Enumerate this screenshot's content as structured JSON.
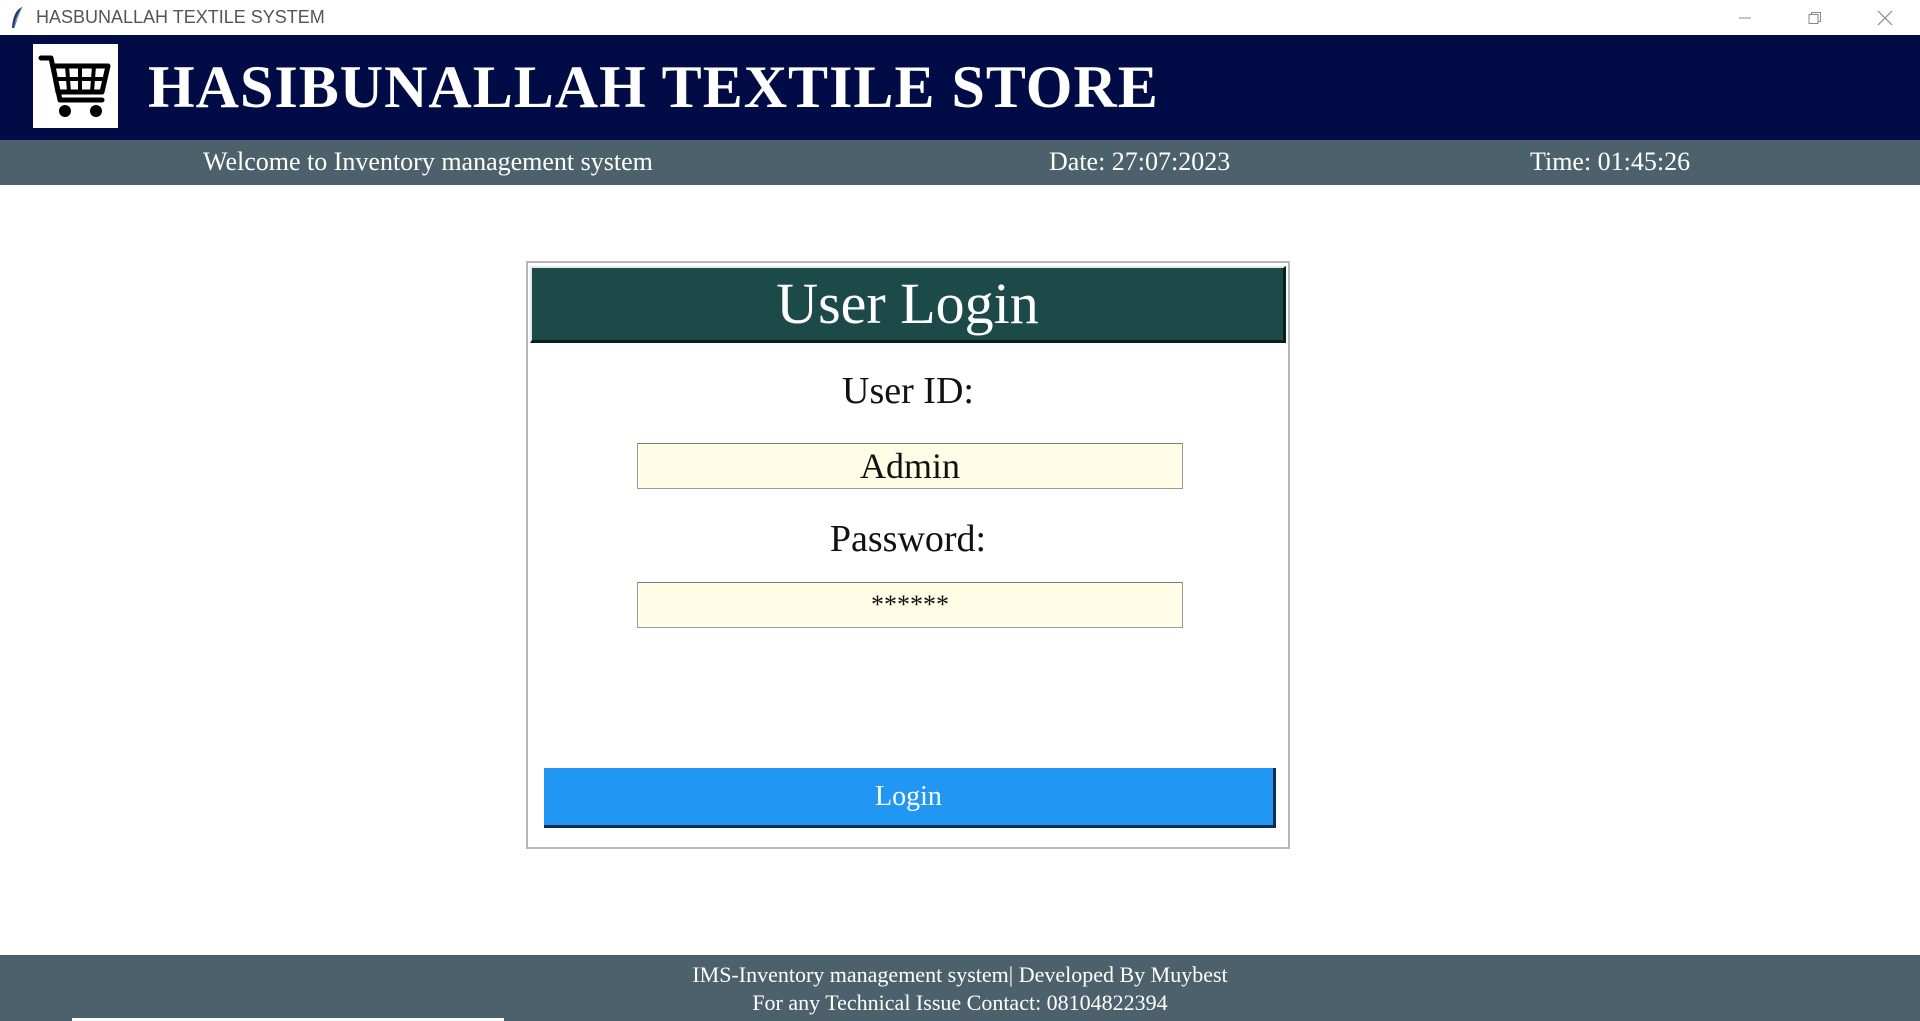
{
  "window": {
    "title": "HASBUNALLAH TEXTILE SYSTEM"
  },
  "header": {
    "store_name": "HASIBUNALLAH TEXTILE STORE",
    "logo_icon": "shopping-cart-icon",
    "background_color": "#010b45"
  },
  "infobar": {
    "welcome": "Welcome to Inventory management system",
    "date": "Date: 27:07:2023",
    "time": "Time: 01:45:26",
    "background_color": "#4d616d"
  },
  "login": {
    "heading": "User Login",
    "user_id_label": "User ID:",
    "user_id_value": "Admin",
    "password_label": "Password:",
    "password_value": "******",
    "button_label": "Login",
    "heading_color": "#1b4a49",
    "button_color": "#2196f3",
    "field_bg_color": "#fffde6"
  },
  "footer": {
    "line1": "IMS-Inventory management system| Developed By Muybest",
    "line2": "For any Technical Issue Contact: 08104822394"
  }
}
